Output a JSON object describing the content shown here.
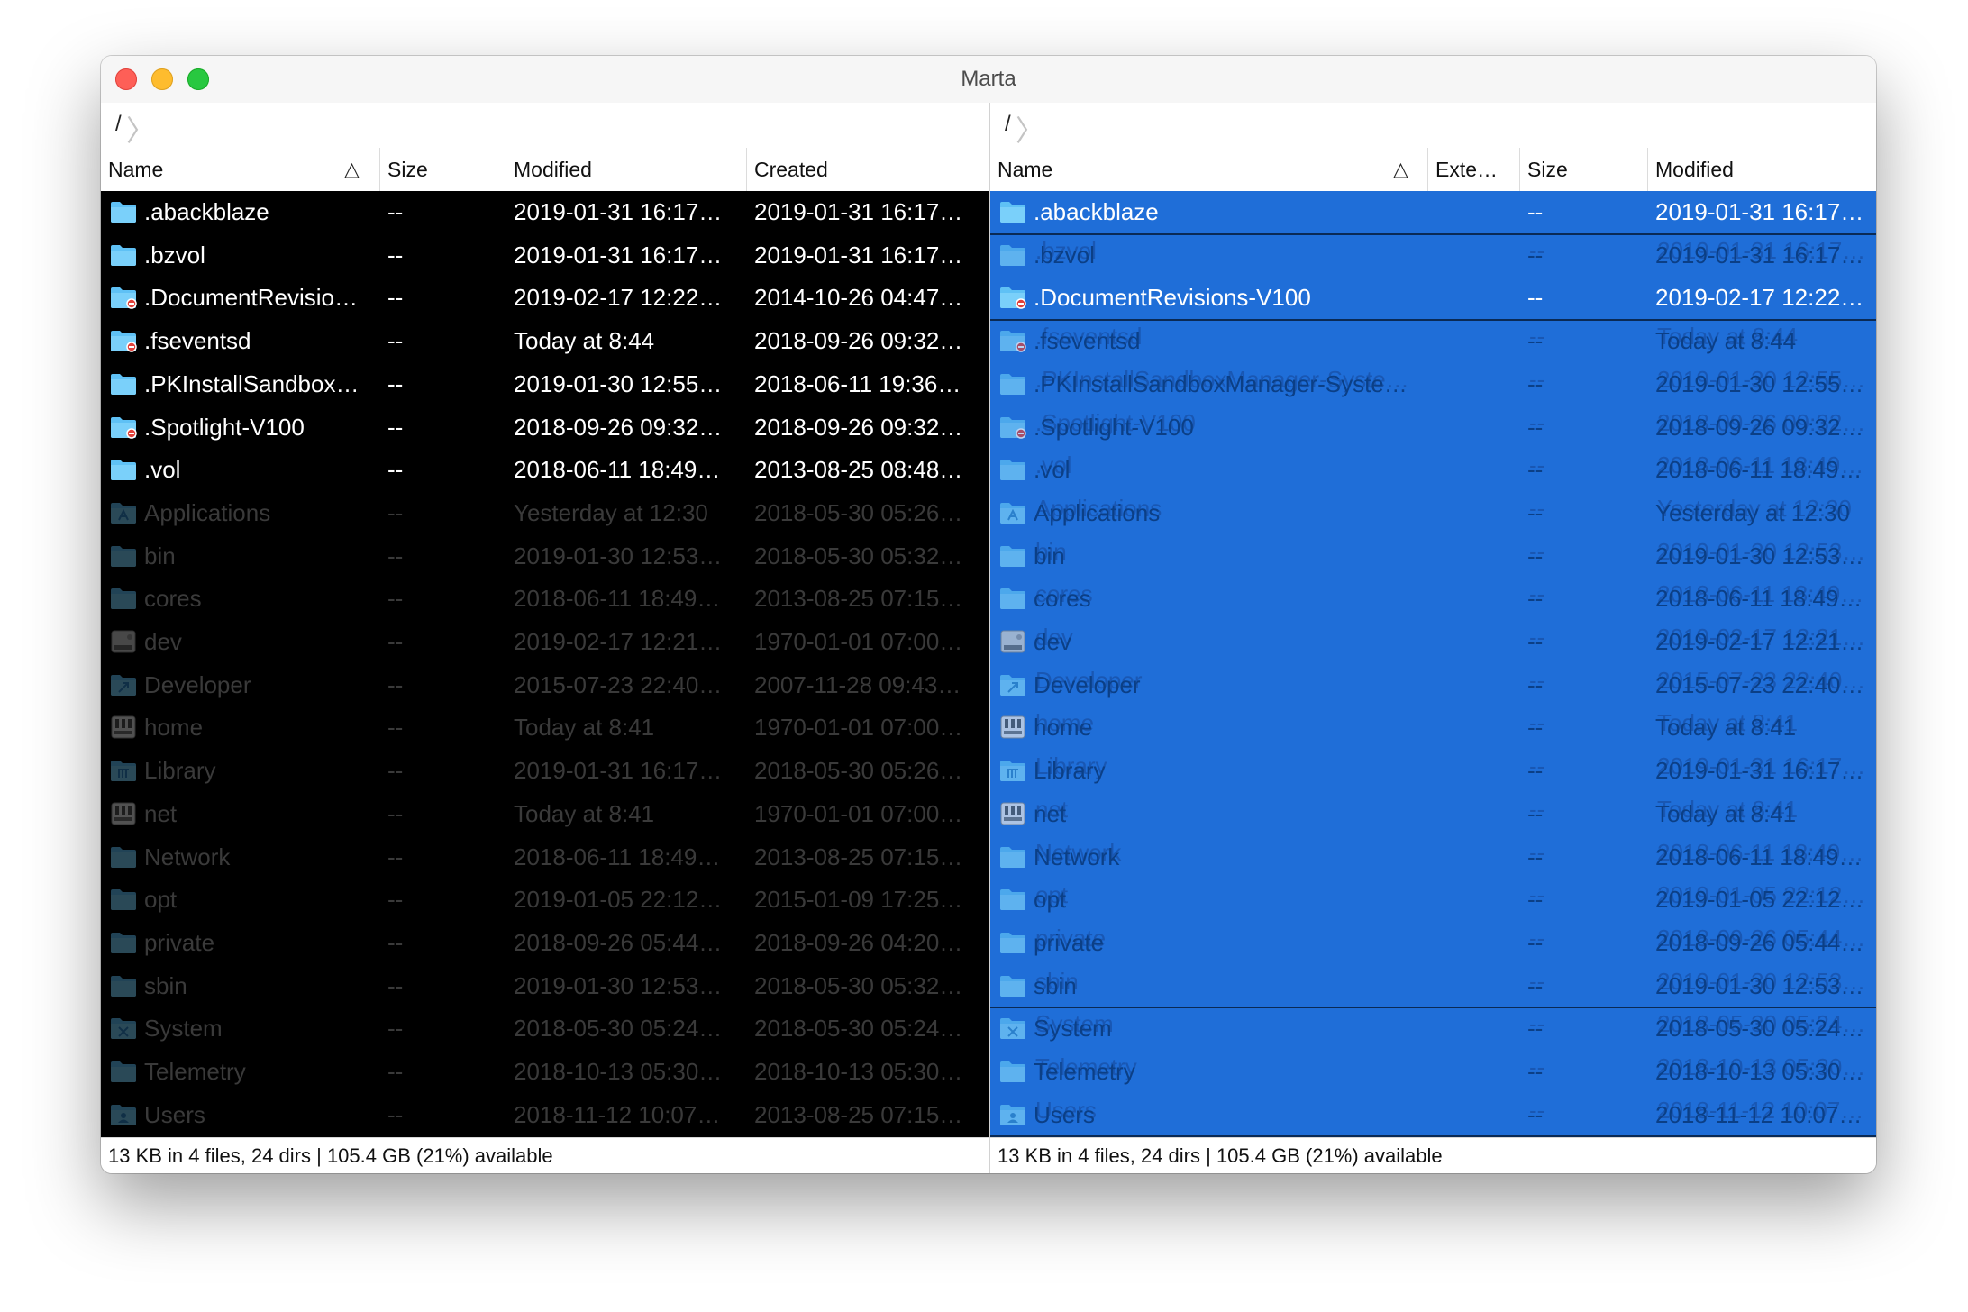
{
  "window": {
    "title": "Marta"
  },
  "panes": [
    {
      "path": "/",
      "columns": [
        "Name",
        "Size",
        "Modified",
        "Created"
      ],
      "status": "13 KB in 4 files, 24 dirs  |  105.4 GB (21%) available",
      "rows": [
        {
          "icon": "folder",
          "name": ".abackblaze",
          "size": "--",
          "modified": "2019-01-31 16:17…",
          "created": "2019-01-31 16:17…",
          "dim": false
        },
        {
          "icon": "folder",
          "name": ".bzvol",
          "size": "--",
          "modified": "2019-01-31 16:17…",
          "created": "2019-01-31 16:17…",
          "dim": false
        },
        {
          "icon": "folder-restricted",
          "name": ".DocumentRevisio…",
          "size": "--",
          "modified": "2019-02-17 12:22…",
          "created": "2014-10-26 04:47…",
          "dim": false
        },
        {
          "icon": "folder-restricted",
          "name": ".fseventsd",
          "size": "--",
          "modified": "Today at 8:44",
          "created": "2018-09-26 09:32…",
          "dim": false
        },
        {
          "icon": "folder",
          "name": ".PKInstallSandbox…",
          "size": "--",
          "modified": "2019-01-30 12:55…",
          "created": "2018-06-11 19:36…",
          "dim": false
        },
        {
          "icon": "folder-restricted",
          "name": ".Spotlight-V100",
          "size": "--",
          "modified": "2018-09-26 09:32…",
          "created": "2018-09-26 09:32…",
          "dim": false
        },
        {
          "icon": "folder",
          "name": ".vol",
          "size": "--",
          "modified": "2018-06-11 18:49…",
          "created": "2013-08-25 08:48…",
          "dim": false
        },
        {
          "icon": "folder-apps",
          "name": "Applications",
          "size": "--",
          "modified": "Yesterday at 12:30",
          "created": "2018-05-30 05:26…",
          "dim": true
        },
        {
          "icon": "folder",
          "name": "bin",
          "size": "--",
          "modified": "2019-01-30 12:53…",
          "created": "2018-05-30 05:32…",
          "dim": true
        },
        {
          "icon": "folder",
          "name": "cores",
          "size": "--",
          "modified": "2018-06-11 18:49…",
          "created": "2013-08-25 07:15…",
          "dim": true
        },
        {
          "icon": "drive",
          "name": "dev",
          "size": "--",
          "modified": "2019-02-17 12:21…",
          "created": "1970-01-01 07:00…",
          "dim": true
        },
        {
          "icon": "folder-dev",
          "name": "Developer",
          "size": "--",
          "modified": "2015-07-23 22:40…",
          "created": "2007-11-28 09:43…",
          "dim": true
        },
        {
          "icon": "server",
          "name": "home",
          "size": "--",
          "modified": "Today at 8:41",
          "created": "1970-01-01 07:00…",
          "dim": true
        },
        {
          "icon": "folder-library",
          "name": "Library",
          "size": "--",
          "modified": "2019-01-31 16:17…",
          "created": "2018-05-30 05:26…",
          "dim": true
        },
        {
          "icon": "server",
          "name": "net",
          "size": "--",
          "modified": "Today at 8:41",
          "created": "1970-01-01 07:00…",
          "dim": true
        },
        {
          "icon": "folder",
          "name": "Network",
          "size": "--",
          "modified": "2018-06-11 18:49…",
          "created": "2013-08-25 07:15…",
          "dim": true
        },
        {
          "icon": "folder",
          "name": "opt",
          "size": "--",
          "modified": "2019-01-05 22:12…",
          "created": "2015-01-09 17:25…",
          "dim": true
        },
        {
          "icon": "folder",
          "name": "private",
          "size": "--",
          "modified": "2018-09-26 05:44…",
          "created": "2018-09-26 04:20…",
          "dim": true
        },
        {
          "icon": "folder",
          "name": "sbin",
          "size": "--",
          "modified": "2019-01-30 12:53…",
          "created": "2018-05-30 05:32…",
          "dim": true
        },
        {
          "icon": "folder-system",
          "name": "System",
          "size": "--",
          "modified": "2018-05-30 05:24…",
          "created": "2018-05-30 05:24…",
          "dim": true
        },
        {
          "icon": "folder",
          "name": "Telemetry",
          "size": "--",
          "modified": "2018-10-13 05:30…",
          "created": "2018-10-13 05:30…",
          "dim": true
        },
        {
          "icon": "folder-users",
          "name": "Users",
          "size": "--",
          "modified": "2018-11-12 10:07…",
          "created": "2013-08-25 07:15…",
          "dim": true
        }
      ]
    },
    {
      "path": "/",
      "columns": [
        "Name",
        "Exte…",
        "Size",
        "Modified"
      ],
      "status": "13 KB in 4 files, 24 dirs  |  105.4 GB (21%) available",
      "rows": [
        {
          "icon": "folder",
          "name": ".abackblaze",
          "size": "--",
          "modified": "2019-01-31 16:17…",
          "dim": false,
          "line": true
        },
        {
          "icon": "folder",
          "name": ".bzvol",
          "size": "--",
          "modified": "2019-01-31 16:17…",
          "dim": true
        },
        {
          "icon": "folder-restricted",
          "name": ".DocumentRevisions-V100",
          "size": "--",
          "modified": "2019-02-17 12:22…",
          "dim": false,
          "line": true
        },
        {
          "icon": "folder-restricted",
          "name": ".fseventsd",
          "size": "--",
          "modified": "Today at 8:44",
          "dim": true
        },
        {
          "icon": "folder",
          "name": ".PKInstallSandboxManager-Syste…",
          "size": "--",
          "modified": "2019-01-30 12:55…",
          "dim": true
        },
        {
          "icon": "folder-restricted",
          "name": ".Spotlight-V100",
          "size": "--",
          "modified": "2018-09-26 09:32…",
          "dim": true
        },
        {
          "icon": "folder",
          "name": ".vol",
          "size": "--",
          "modified": "2018-06-11 18:49…",
          "dim": true
        },
        {
          "icon": "folder-apps",
          "name": "Applications",
          "size": "--",
          "modified": "Yesterday at 12:30",
          "dim": true
        },
        {
          "icon": "folder",
          "name": "bin",
          "size": "--",
          "modified": "2019-01-30 12:53…",
          "dim": true
        },
        {
          "icon": "folder",
          "name": "cores",
          "size": "--",
          "modified": "2018-06-11 18:49…",
          "dim": true
        },
        {
          "icon": "drive",
          "name": "dev",
          "size": "--",
          "modified": "2019-02-17 12:21…",
          "dim": true
        },
        {
          "icon": "folder-dev",
          "name": "Developer",
          "size": "--",
          "modified": "2015-07-23 22:40…",
          "dim": true
        },
        {
          "icon": "server",
          "name": "home",
          "size": "--",
          "modified": "Today at 8:41",
          "dim": true
        },
        {
          "icon": "folder-library",
          "name": "Library",
          "size": "--",
          "modified": "2019-01-31 16:17…",
          "dim": true
        },
        {
          "icon": "server",
          "name": "net",
          "size": "--",
          "modified": "Today at 8:41",
          "dim": true
        },
        {
          "icon": "folder",
          "name": "Network",
          "size": "--",
          "modified": "2018-06-11 18:49…",
          "dim": true
        },
        {
          "icon": "folder",
          "name": "opt",
          "size": "--",
          "modified": "2019-01-05 22:12…",
          "dim": true
        },
        {
          "icon": "folder",
          "name": "private",
          "size": "--",
          "modified": "2018-09-26 05:44…",
          "dim": true
        },
        {
          "icon": "folder",
          "name": "sbin",
          "size": "--",
          "modified": "2019-01-30 12:53…",
          "dim": true,
          "line": true
        },
        {
          "icon": "folder-system",
          "name": "System",
          "size": "--",
          "modified": "2018-05-30 05:24…",
          "dim": true
        },
        {
          "icon": "folder",
          "name": "Telemetry",
          "size": "--",
          "modified": "2018-10-13 05:30…",
          "dim": true
        },
        {
          "icon": "folder-users",
          "name": "Users",
          "size": "--",
          "modified": "2018-11-12 10:07…",
          "dim": true,
          "line": true
        }
      ]
    }
  ],
  "colors": {
    "selection_blue": "#1f6ed8",
    "folder_blue": "#5fc1f5",
    "restricted_red": "#e0413b"
  }
}
